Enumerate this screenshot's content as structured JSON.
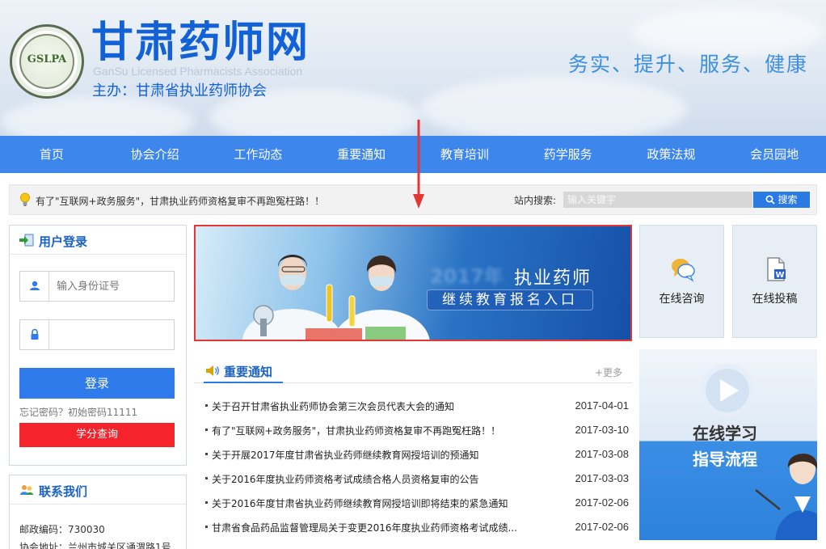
{
  "header": {
    "logo_abbr": "GSLPA",
    "site_title": "甘肃药师网",
    "site_subtitle": "GanSu Licensed Pharmacists Association",
    "host": "主办：甘肃省执业药师协会",
    "slogan": "务实、提升、服务、健康"
  },
  "nav": {
    "items": [
      "首页",
      "协会介绍",
      "工作动态",
      "重要通知",
      "教育培训",
      "药学服务",
      "政策法规",
      "会员园地"
    ]
  },
  "notice_bar": {
    "text": "有了\"互联网+政务服务\"，甘肃执业药师资格复审不再跑冤枉路！！",
    "search_label": "站内搜索:",
    "search_placeholder": "输入关键字",
    "search_button": "搜索"
  },
  "login": {
    "title": "用户登录",
    "id_placeholder": "输入身份证号",
    "password_placeholder": "",
    "login_button": "登录",
    "forgot_text": "忘记密码？初始密码11111",
    "credit_button": "学分查询"
  },
  "contact": {
    "title": "联系我们",
    "postcode": "邮政编码：730030",
    "address": "协会地址：兰州市城关区通渭路1号"
  },
  "banner": {
    "year_text": "2017年",
    "line1": "执业药师",
    "line2": "继续教育报名入口"
  },
  "notices": {
    "title": "重要通知",
    "more": "+更多",
    "items": [
      {
        "title": "关于召开甘肃省执业药师协会第三次会员代表大会的通知",
        "date": "2017-04-01"
      },
      {
        "title": "有了\"互联网+政务服务\"，甘肃执业药师资格复审不再跑冤枉路！！",
        "date": "2017-03-10"
      },
      {
        "title": "关于开展2017年度甘肃省执业药师继续教育网授培训的预通知",
        "date": "2017-03-08"
      },
      {
        "title": "关于2016年度执业药师资格考试成绩合格人员资格复审的公告",
        "date": "2017-03-03"
      },
      {
        "title": "关于2016年度甘肃省执业药师继续教育网授培训即将结束的紧急通知",
        "date": "2017-02-06"
      },
      {
        "title": "甘肃省食品药品监督管理局关于变更2016年度执业药师资格考试成绩...",
        "date": "2017-02-06"
      }
    ]
  },
  "tiles": {
    "consult": "在线咨询",
    "submit": "在线投稿"
  },
  "study": {
    "line1": "在线学习",
    "line2": "指导流程"
  },
  "colors": {
    "brand_blue": "#1261d6",
    "nav_blue": "#3d86ec",
    "login_blue": "#2f7bec",
    "credit_red": "#f4232c",
    "highlight_red": "#e53636"
  }
}
